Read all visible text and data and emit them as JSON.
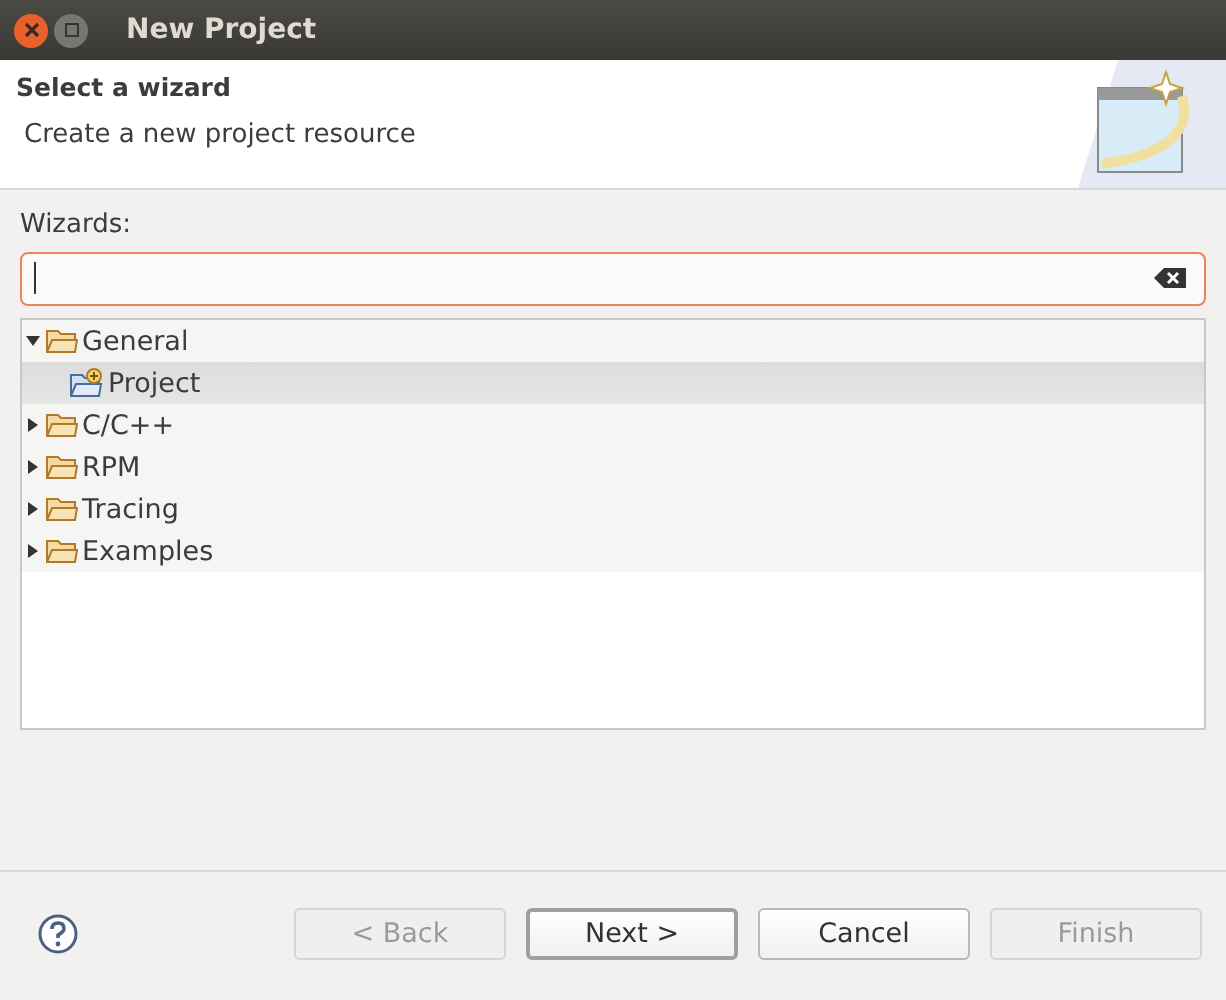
{
  "window": {
    "title": "New Project"
  },
  "header": {
    "title": "Select a wizard",
    "description": "Create a new project resource"
  },
  "wizards": {
    "label": "Wizards:",
    "tree": [
      {
        "label": "General",
        "expanded": true,
        "kind": "folder",
        "children": [
          {
            "label": "Project",
            "kind": "project",
            "selected": true
          }
        ],
        "selected": false
      },
      {
        "label": "C/C++",
        "expanded": false,
        "kind": "folder",
        "selected": false
      },
      {
        "label": "RPM",
        "expanded": false,
        "kind": "folder",
        "selected": false
      },
      {
        "label": "Tracing",
        "expanded": false,
        "kind": "folder",
        "selected": false
      },
      {
        "label": "Examples",
        "expanded": false,
        "kind": "folder",
        "selected": false
      }
    ]
  },
  "buttons": [
    {
      "label": "< Back",
      "disabled": true,
      "default": false
    },
    {
      "label": "Next >",
      "disabled": false,
      "default": true
    },
    {
      "label": "Cancel",
      "disabled": false,
      "default": false
    },
    {
      "label": "Finish",
      "disabled": true,
      "default": false
    }
  ]
}
